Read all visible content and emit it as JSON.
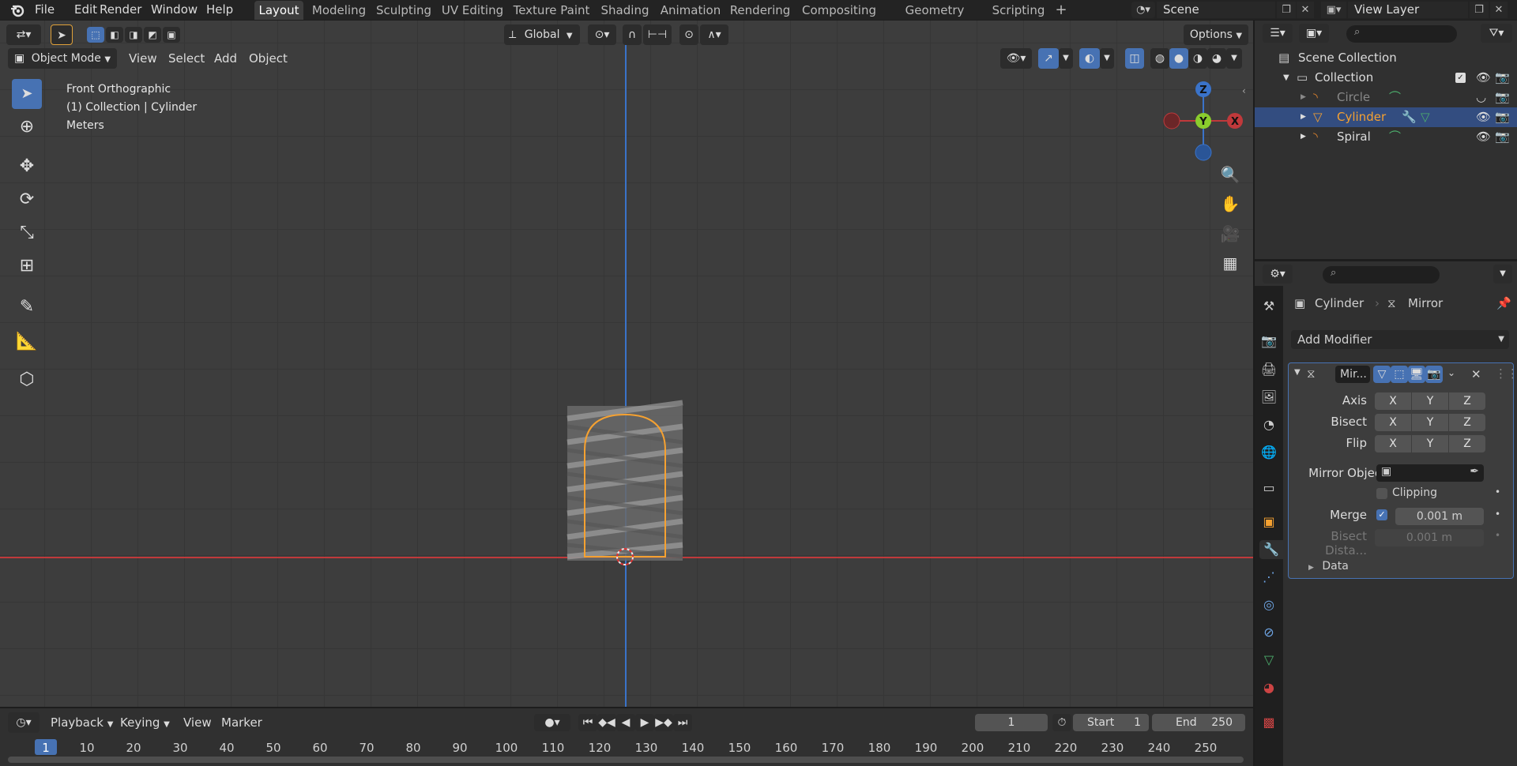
{
  "app": {
    "logo": "blender-logo-icon"
  },
  "menu": [
    "File",
    "Edit",
    "Render",
    "Window",
    "Help"
  ],
  "workspaces": [
    "Layout",
    "Modeling",
    "Sculpting",
    "UV Editing",
    "Texture Paint",
    "Shading",
    "Animation",
    "Rendering",
    "Compositing",
    "Geometry Nodes",
    "Scripting"
  ],
  "add_tab": "+",
  "scene": {
    "name": "Scene"
  },
  "view_layer": {
    "name": "View Layer"
  },
  "toolbar_top": {
    "orientation": "Global",
    "options": "Options"
  },
  "viewport_header": {
    "mode": "Object Mode",
    "menus": [
      "View",
      "Select",
      "Add",
      "Object"
    ]
  },
  "viewport_info": {
    "view": "Front Orthographic",
    "collection": "(1) Collection | Cylinder",
    "units": "Meters"
  },
  "gizmo": {
    "z": "Z",
    "y": "Y",
    "x": "X"
  },
  "outliner": {
    "root": "Scene Collection",
    "collection": "Collection",
    "items": [
      {
        "name": "Circle",
        "dim": true
      },
      {
        "name": "Cylinder",
        "selected": true
      },
      {
        "name": "Spiral",
        "dim": false
      }
    ]
  },
  "properties": {
    "breadcrumb_object": "Cylinder",
    "breadcrumb_modifier": "Mirror",
    "add_modifier": "Add Modifier",
    "modifier_name": "Mir...",
    "axis_label": "Axis",
    "bisect_label": "Bisect",
    "flip_label": "Flip",
    "x": "X",
    "y": "Y",
    "z": "Z",
    "mirror_object_label": "Mirror Object",
    "clipping_label": "Clipping",
    "merge_label": "Merge",
    "merge_value": "0.001 m",
    "bisect_distance_label": "Bisect Dista...",
    "bisect_distance_value": "0.001 m",
    "data_label": "Data"
  },
  "timeline": {
    "menus": [
      "Playback",
      "Keying",
      "View",
      "Marker"
    ],
    "current_frame": "1",
    "start_label": "Start",
    "start_value": "1",
    "end_label": "End",
    "end_value": "250",
    "ticks": [
      "1",
      "10",
      "20",
      "30",
      "40",
      "50",
      "60",
      "70",
      "80",
      "90",
      "100",
      "110",
      "120",
      "130",
      "140",
      "150",
      "160",
      "170",
      "180",
      "190",
      "200",
      "210",
      "220",
      "230",
      "240",
      "250"
    ]
  },
  "colors": {
    "accent": "#4772b3",
    "selected_orange": "#f5a131",
    "x_axis": "#c0393b",
    "z_axis": "#3a73c9",
    "y_axis": "#8acc2d"
  }
}
